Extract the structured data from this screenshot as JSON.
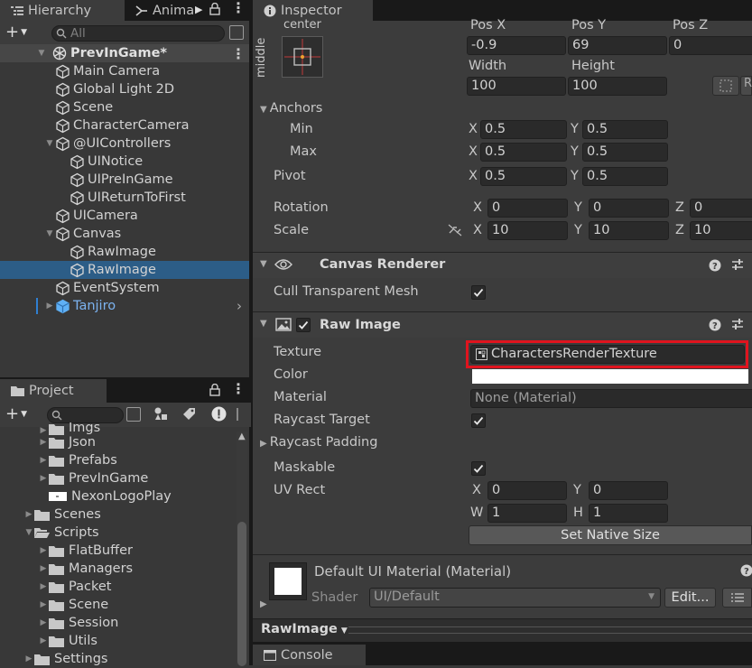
{
  "hierarchy": {
    "tab_label": "Hierarchy",
    "animation_tab_label": "Anima",
    "search_placeholder": "All",
    "scene_name": "PrevInGame*",
    "items": [
      {
        "label": "Main Camera"
      },
      {
        "label": "Global Light 2D"
      },
      {
        "label": "Scene"
      },
      {
        "label": "CharacterCamera"
      },
      {
        "label": "@UIControllers"
      },
      {
        "label": "UINotice"
      },
      {
        "label": "UIPreInGame"
      },
      {
        "label": "UIReturnToFirst"
      },
      {
        "label": "UICamera"
      },
      {
        "label": "Canvas"
      },
      {
        "label": "RawImage"
      },
      {
        "label": "RawImage",
        "selected": true
      },
      {
        "label": "EventSystem"
      },
      {
        "label": "Tanjiro",
        "prefab": true
      }
    ]
  },
  "project": {
    "tab_label": "Project",
    "items": [
      {
        "label": "Imgs"
      },
      {
        "label": "Json"
      },
      {
        "label": "Prefabs"
      },
      {
        "label": "PrevInGame"
      },
      {
        "label": "NexonLogoPlay"
      },
      {
        "label": "Scenes"
      },
      {
        "label": "Scripts"
      },
      {
        "label": "FlatBuffer"
      },
      {
        "label": "Managers"
      },
      {
        "label": "Packet"
      },
      {
        "label": "Scene"
      },
      {
        "label": "Session"
      },
      {
        "label": "Utils"
      },
      {
        "label": "Settings"
      }
    ]
  },
  "inspector": {
    "tab_label": "Inspector",
    "anchor_preset": {
      "top": "center",
      "side": "middle"
    },
    "rect": {
      "pos_x_label": "Pos X",
      "pos_y_label": "Pos Y",
      "pos_z_label": "Pos Z",
      "pos_x": "-0.9",
      "pos_y": "69",
      "pos_z": "0",
      "width_label": "Width",
      "height_label": "Height",
      "width": "100",
      "height": "100"
    },
    "anchors": {
      "label": "Anchors",
      "min_label": "Min",
      "max_label": "Max",
      "min_x": "0.5",
      "min_y": "0.5",
      "max_x": "0.5",
      "max_y": "0.5"
    },
    "pivot": {
      "label": "Pivot",
      "x": "0.5",
      "y": "0.5"
    },
    "rotation": {
      "label": "Rotation",
      "x": "0",
      "y": "0",
      "z": "0"
    },
    "scale": {
      "label": "Scale",
      "x": "10",
      "y": "10",
      "z": "10"
    },
    "axis_labels": {
      "x": "X",
      "y": "Y",
      "z": "Z",
      "w": "W",
      "h": "H"
    },
    "canvas_renderer": {
      "title": "Canvas Renderer",
      "cull_label": "Cull Transparent Mesh",
      "cull_checked": true
    },
    "raw_image": {
      "title": "Raw Image",
      "texture_label": "Texture",
      "texture_value": "CharactersRenderTexture",
      "color_label": "Color",
      "color_value": "#ffffff",
      "material_label": "Material",
      "material_value": "None (Material)",
      "raycast_target_label": "Raycast Target",
      "raycast_target_checked": true,
      "raycast_padding_label": "Raycast Padding",
      "maskable_label": "Maskable",
      "maskable_checked": true,
      "uv_rect_label": "UV Rect",
      "uv_x": "0",
      "uv_y": "0",
      "uv_w": "1",
      "uv_h": "1",
      "set_native_size_label": "Set Native Size"
    },
    "material_section": {
      "title": "Default UI Material (Material)",
      "shader_label": "Shader",
      "shader_value": "UI/Default",
      "edit_label": "Edit..."
    },
    "preview": {
      "label": "RawImage"
    }
  },
  "console": {
    "tab_label": "Console"
  },
  "colors": {
    "selection": "#2c5d87",
    "highlight_border": "#e0141e",
    "prefab_text": "#7cb3f0"
  }
}
